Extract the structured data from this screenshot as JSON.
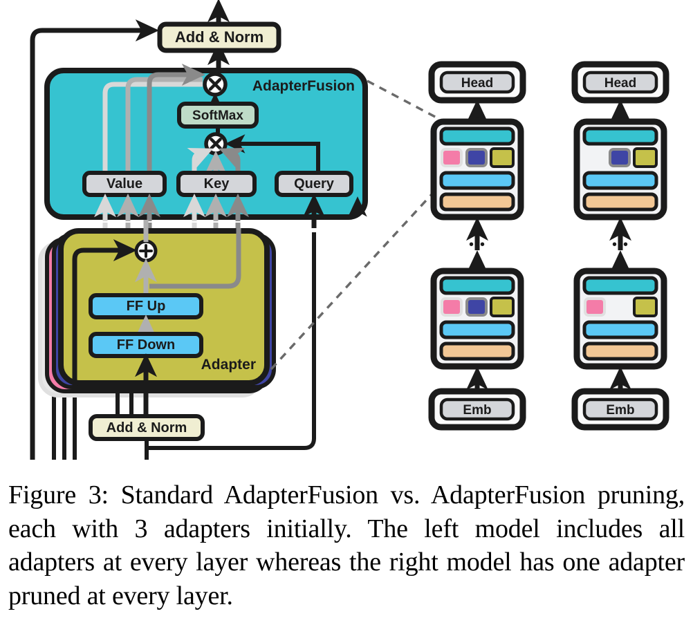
{
  "figure": {
    "caption": "Figure 3: Standard AdapterFusion vs.  AdapterFusion pruning, each with 3 adapters initially.  The left model includes all adapters at every layer whereas the right model has one adapter pruned at every layer.",
    "left_diagram": {
      "top_add_norm": "Add & Norm",
      "fusion_title": "AdapterFusion",
      "softmax": "SoftMax",
      "value": "Value",
      "key": "Key",
      "query": "Query",
      "ff_up": "FF Up",
      "ff_down": "FF Down",
      "adapter_title": "Adapter",
      "bottom_add_norm": "Add & Norm",
      "mult_symbol": "⊗",
      "plus_symbol": "⊕"
    },
    "right_models": [
      {
        "name": "standard-adapterfusion-model",
        "head": "Head",
        "emb": "Emb",
        "ellipsis": "•••",
        "top_layer_adapters": [
          "pink",
          "navy",
          "olive"
        ],
        "bottom_layer_adapters": [
          "pink",
          "navy",
          "olive"
        ]
      },
      {
        "name": "pruned-adapterfusion-model",
        "head": "Head",
        "emb": "Emb",
        "ellipsis": "•••",
        "top_layer_adapters": [
          "navy",
          "olive"
        ],
        "bottom_layer_adapters": [
          "pink",
          "olive"
        ]
      }
    ],
    "colors": {
      "fusion_fill": "#36c3d0",
      "adapter_fill": "#c5c14a",
      "adapter_stack_navy": "#3f45a5",
      "adapter_stack_pink": "#f47ca8",
      "adapter_stack_gray": "#e8e8e8",
      "addnorm_fill": "#f0eed2",
      "softmax_fill": "#bfdcc8",
      "vkq_fill": "#d4d6da",
      "ff_fill": "#5bc8f5",
      "layer_fusion_bar": "#36c3d0",
      "layer_ff_bar": "#5bc8f5",
      "layer_attn_bar": "#f2c795",
      "layer_card_fill": "#f2f3f5",
      "head_fill": "#d4d6da",
      "emb_fill": "#d4d6da",
      "stroke": "#1b1b1b"
    }
  }
}
